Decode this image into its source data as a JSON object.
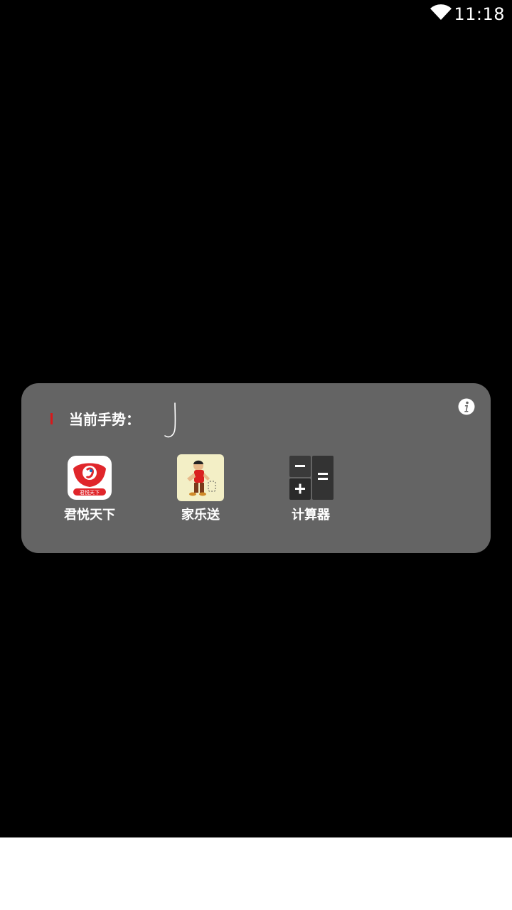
{
  "status_bar": {
    "time": "11:18",
    "wifi_icon": "wifi-icon"
  },
  "gesture_panel": {
    "label": "当前手势：",
    "info_icon": "info-icon",
    "apps": [
      {
        "label": "君悦天下",
        "icon": "junyue-tianxia-app-icon",
        "icon_text": "君悦天下"
      },
      {
        "label": "家乐送",
        "icon": "jialesong-app-icon"
      },
      {
        "label": "计算器",
        "icon": "calculator-app-icon"
      }
    ]
  },
  "colors": {
    "background": "#000000",
    "panel": "#646464",
    "accent_red": "#d8181a"
  }
}
